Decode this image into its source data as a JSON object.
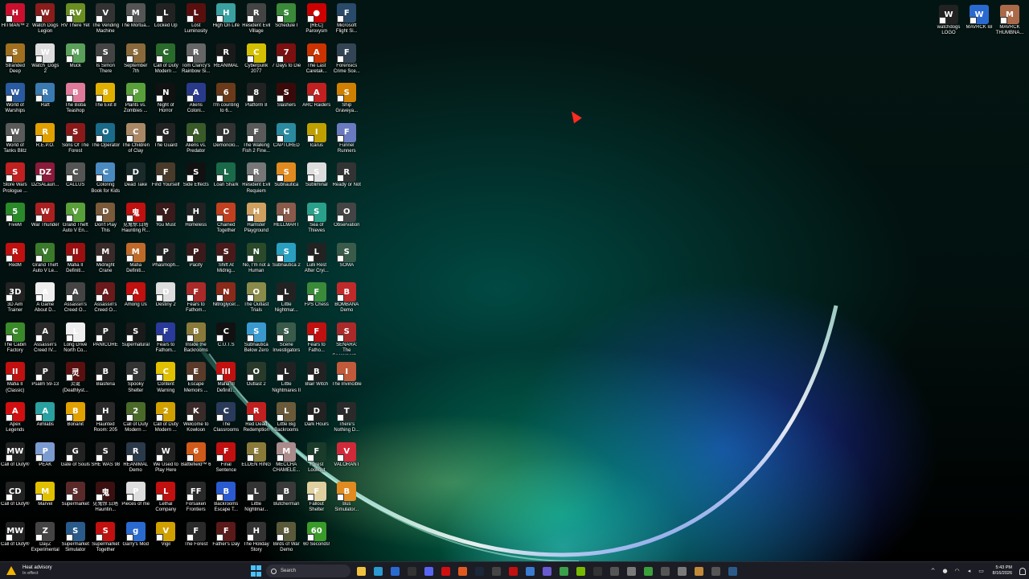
{
  "desktop": {
    "icons": [
      {
        "label": "HITMAN™ 2",
        "glyph": "H",
        "color": "#c8102e"
      },
      {
        "label": "Watch Dogs Legion",
        "glyph": "W",
        "color": "#8a1c1c"
      },
      {
        "label": "RV There Yet",
        "glyph": "RV",
        "color": "#6b8e23"
      },
      {
        "label": "The Vending Machine",
        "glyph": "V",
        "color": "#333333"
      },
      {
        "label": "The Mortua...",
        "glyph": "M",
        "color": "#555555"
      },
      {
        "label": "Locked Up",
        "glyph": "L",
        "color": "#222222"
      },
      {
        "label": "Lost Luminosity",
        "glyph": "L",
        "color": "#5a0f0f"
      },
      {
        "label": "High On Life",
        "glyph": "H",
        "color": "#3aa0a0"
      },
      {
        "label": "Resident Evil Village",
        "glyph": "R",
        "color": "#444444"
      },
      {
        "label": "Schedule I",
        "glyph": "S",
        "color": "#3a8a3a"
      },
      {
        "label": "[REC] Paroxysm",
        "glyph": "●",
        "color": "#cc0000"
      },
      {
        "label": "Microsoft Flight Si...",
        "glyph": "F",
        "color": "#2a4a6a"
      },
      {
        "label": "Stranded Deep",
        "glyph": "S",
        "color": "#a07020"
      },
      {
        "label": "Watch_Dogs 2",
        "glyph": "W",
        "color": "#dddddd"
      },
      {
        "label": "Muck",
        "glyph": "M",
        "color": "#5aa05a"
      },
      {
        "label": "Is Simon There",
        "glyph": "S",
        "color": "#444444"
      },
      {
        "label": "September 7th",
        "glyph": "S",
        "color": "#8a6a3a"
      },
      {
        "label": "Call of Duty Modern ...",
        "glyph": "C",
        "color": "#2a6a2a"
      },
      {
        "label": "Tom Clancy's Rainbow Si...",
        "glyph": "R",
        "color": "#666666"
      },
      {
        "label": "REANIMAL",
        "glyph": "R",
        "color": "#1a1a1a"
      },
      {
        "label": "Cyberpunk 2077",
        "glyph": "C",
        "color": "#d4c000"
      },
      {
        "label": "7 Days to Die",
        "glyph": "7",
        "color": "#7a1010"
      },
      {
        "label": "The Last Caretak...",
        "glyph": "A",
        "color": "#cc3300"
      },
      {
        "label": "Forensics Crime Sce...",
        "glyph": "F",
        "color": "#334455"
      },
      {
        "label": "World of Warships",
        "glyph": "W",
        "color": "#2a5aa0"
      },
      {
        "label": "Raft",
        "glyph": "R",
        "color": "#3a7ab0"
      },
      {
        "label": "The Boba Teashop",
        "glyph": "B",
        "color": "#e07a9a"
      },
      {
        "label": "The Exit 8",
        "glyph": "8",
        "color": "#e0b000"
      },
      {
        "label": "Plants vs. Zombies ...",
        "glyph": "P",
        "color": "#5aa03a"
      },
      {
        "label": "Night of Horror",
        "glyph": "N",
        "color": "#111111"
      },
      {
        "label": "Aliens Coloni...",
        "glyph": "A",
        "color": "#2a3a8a"
      },
      {
        "label": "I'm counting to 6...",
        "glyph": "6",
        "color": "#6a3a1a"
      },
      {
        "label": "Platform 8",
        "glyph": "8",
        "color": "#222222"
      },
      {
        "label": "Slashers",
        "glyph": "S",
        "color": "#3a0a0a"
      },
      {
        "label": "ARC Raiders",
        "glyph": "A",
        "color": "#c02020"
      },
      {
        "label": "Ship Graveya...",
        "glyph": "S",
        "color": "#d08000"
      },
      {
        "label": "World of Tanks Blitz",
        "glyph": "W",
        "color": "#5a5a5a"
      },
      {
        "label": "R.E.P.O.",
        "glyph": "R",
        "color": "#e0a000"
      },
      {
        "label": "Sons Of The Forest",
        "glyph": "S",
        "color": "#8a1a1a"
      },
      {
        "label": "The Operator",
        "glyph": "O",
        "color": "#1a6a8a"
      },
      {
        "label": "The Children of Clay",
        "glyph": "C",
        "color": "#aa8866"
      },
      {
        "label": "The Guard",
        "glyph": "G",
        "color": "#222222"
      },
      {
        "label": "Aliens vs. Predator",
        "glyph": "A",
        "color": "#3a5a2a"
      },
      {
        "label": "Demonolo...",
        "glyph": "D",
        "color": "#333333"
      },
      {
        "label": "The Walking Fish 2 Fine...",
        "glyph": "F",
        "color": "#5a5a5a"
      },
      {
        "label": "CAPTURED",
        "glyph": "C",
        "color": "#2a8aa0"
      },
      {
        "label": "Icarus",
        "glyph": "I",
        "color": "#c0a000"
      },
      {
        "label": "Funnel Runners",
        "glyph": "F",
        "color": "#6a7ac0"
      },
      {
        "label": "Store Wars Prologue ...",
        "glyph": "S",
        "color": "#c02020"
      },
      {
        "label": "DZSALaun...",
        "glyph": "DZ",
        "color": "#8a1a3a"
      },
      {
        "label": "CALLUS",
        "glyph": "C",
        "color": "#555555"
      },
      {
        "label": "Coloring Book for Kids",
        "glyph": "C",
        "color": "#4a8ac0"
      },
      {
        "label": "Dead Take",
        "glyph": "D",
        "color": "#1a2a2a"
      },
      {
        "label": "Find Yourself",
        "glyph": "F",
        "color": "#4a3a2a"
      },
      {
        "label": "Side Effects",
        "glyph": "S",
        "color": "#111111"
      },
      {
        "label": "Loan Shark",
        "glyph": "L",
        "color": "#1a6a4a"
      },
      {
        "label": "Resident Evil Requiem",
        "glyph": "R",
        "color": "#777777"
      },
      {
        "label": "Subnautica",
        "glyph": "S",
        "color": "#e08a20"
      },
      {
        "label": "Subliminal",
        "glyph": "S",
        "color": "#dddddd"
      },
      {
        "label": "Ready or Not",
        "glyph": "R",
        "color": "#333333"
      },
      {
        "label": "FiveM",
        "glyph": "5",
        "color": "#2a8a2a"
      },
      {
        "label": "War Thunder",
        "glyph": "W",
        "color": "#aa2020"
      },
      {
        "label": "Grand Theft Auto V En...",
        "glyph": "V",
        "color": "#5aa03a"
      },
      {
        "label": "Don't Play This",
        "glyph": "D",
        "color": "#7a5a3a"
      },
      {
        "label": "见鬼惊:白塔 Haunting R...",
        "glyph": "鬼",
        "color": "#c01010"
      },
      {
        "label": "You Must",
        "glyph": "Y",
        "color": "#3a1a1a"
      },
      {
        "label": "Homeless",
        "glyph": "H",
        "color": "#222222"
      },
      {
        "label": "Chained Together",
        "glyph": "C",
        "color": "#c04020"
      },
      {
        "label": "Hamster Playground",
        "glyph": "H",
        "color": "#d0a060"
      },
      {
        "label": "HELLMART",
        "glyph": "H",
        "color": "#8a5a4a"
      },
      {
        "label": "Sea of Thieves",
        "glyph": "S",
        "color": "#2aa08a"
      },
      {
        "label": "Observation",
        "glyph": "O",
        "color": "#444444"
      },
      {
        "label": "RedM",
        "glyph": "R",
        "color": "#c01010"
      },
      {
        "label": "Grand Theft Auto V Le...",
        "glyph": "V",
        "color": "#3a7a2a"
      },
      {
        "label": "Mafia II Definiti...",
        "glyph": "II",
        "color": "#9a1010"
      },
      {
        "label": "Midnight Crane",
        "glyph": "M",
        "color": "#3a2a2a"
      },
      {
        "label": "Mafia Definiti...",
        "glyph": "M",
        "color": "#c06a2a"
      },
      {
        "label": "Phasmoph...",
        "glyph": "P",
        "color": "#222222"
      },
      {
        "label": "Pacify",
        "glyph": "P",
        "color": "#3a1a1a"
      },
      {
        "label": "Shift At Midnig...",
        "glyph": "S",
        "color": "#4a1a1a"
      },
      {
        "label": "No, I'm not a Human",
        "glyph": "N",
        "color": "#2a4a2a"
      },
      {
        "label": "Subnautica 2",
        "glyph": "S",
        "color": "#2aa0c0"
      },
      {
        "label": "Lulli Rest After Cryi...",
        "glyph": "L",
        "color": "#222222"
      },
      {
        "label": "SOMA",
        "glyph": "S",
        "color": "#3a5a4a"
      },
      {
        "label": "3D Aim Trainer",
        "glyph": "3D",
        "color": "#222222"
      },
      {
        "label": "A Game About D...",
        "glyph": "A",
        "color": "#eeeeee"
      },
      {
        "label": "Assassin's Creed O...",
        "glyph": "A",
        "color": "#444444"
      },
      {
        "label": "Assassin's Creed O...",
        "glyph": "A",
        "color": "#6a1a1a"
      },
      {
        "label": "Among Us",
        "glyph": "A",
        "color": "#c01010"
      },
      {
        "label": "Destiny 2",
        "glyph": "D",
        "color": "#dddddd"
      },
      {
        "label": "Fears to Fathom...",
        "glyph": "F",
        "color": "#aa2a2a"
      },
      {
        "label": "Nitroglycer...",
        "glyph": "N",
        "color": "#8a2a1a"
      },
      {
        "label": "The Outlast Trials",
        "glyph": "O",
        "color": "#8a8a4a"
      },
      {
        "label": "Little Nightmar...",
        "glyph": "L",
        "color": "#222222"
      },
      {
        "label": "FPS Chess",
        "glyph": "F",
        "color": "#3a8a3a"
      },
      {
        "label": "BOMBANA Demo",
        "glyph": "B",
        "color": "#c02a2a"
      },
      {
        "label": "The Cabin Factory",
        "glyph": "C",
        "color": "#3a8a2a"
      },
      {
        "label": "Assassin's Creed IV...",
        "glyph": "A",
        "color": "#2a2a2a"
      },
      {
        "label": "Long Drive North Co...",
        "glyph": "L",
        "color": "#eeeeee"
      },
      {
        "label": "PANICORE",
        "glyph": "P",
        "color": "#222222"
      },
      {
        "label": "Supernatural",
        "glyph": "S",
        "color": "#1a1a1a"
      },
      {
        "label": "Fears to Fathom...",
        "glyph": "F",
        "color": "#2a3a9a"
      },
      {
        "label": "Inside the Backrooms",
        "glyph": "B",
        "color": "#8a7a3a"
      },
      {
        "label": "C.U.T.S",
        "glyph": "C",
        "color": "#111111"
      },
      {
        "label": "Subnautica Below Zero",
        "glyph": "S",
        "color": "#3a9ad0"
      },
      {
        "label": "Scene Investigators",
        "glyph": "S",
        "color": "#3a5a4a"
      },
      {
        "label": "Fears to Fatho...",
        "glyph": "F",
        "color": "#c01010"
      },
      {
        "label": "SENARA: The Sacrament ...",
        "glyph": "S",
        "color": "#aa2a2a"
      },
      {
        "label": "Mafia II (Classic)",
        "glyph": "II",
        "color": "#c01010"
      },
      {
        "label": "Psalm 59-13",
        "glyph": "P",
        "color": "#222222"
      },
      {
        "label": "灵诞 (Deathlyst...",
        "glyph": "灵",
        "color": "#5a1010"
      },
      {
        "label": "Blasferia",
        "glyph": "B",
        "color": "#222222"
      },
      {
        "label": "Spooky Shelter",
        "glyph": "S",
        "color": "#333333"
      },
      {
        "label": "Content Warning",
        "glyph": "C",
        "color": "#e0c000"
      },
      {
        "label": "Escape Memoirs ...",
        "glyph": "E",
        "color": "#5a3a2a"
      },
      {
        "label": "Mafia III Definiti...",
        "glyph": "III",
        "color": "#c01010"
      },
      {
        "label": "Outlast 2",
        "glyph": "O",
        "color": "#2a3a2a"
      },
      {
        "label": "Little Nightmares II",
        "glyph": "L",
        "color": "#222222"
      },
      {
        "label": "Blair Witch",
        "glyph": "B",
        "color": "#222222"
      },
      {
        "label": "The Invincible",
        "glyph": "I",
        "color": "#c05a3a"
      },
      {
        "label": "Apex Legends",
        "glyph": "A",
        "color": "#d01010"
      },
      {
        "label": "Aimlabs",
        "glyph": "A",
        "color": "#2aa0a0"
      },
      {
        "label": "Bonanit",
        "glyph": "B",
        "color": "#e0a000"
      },
      {
        "label": "Haunted Room: 205",
        "glyph": "H",
        "color": "#2a2a2a"
      },
      {
        "label": "Call of Duty Modern ...",
        "glyph": "2",
        "color": "#4a6a2a"
      },
      {
        "label": "Call of Duty Modern ...",
        "glyph": "2",
        "color": "#d0a000"
      },
      {
        "label": "Welcome to Kowloon",
        "glyph": "K",
        "color": "#3a2a2a"
      },
      {
        "label": "The Classrooms",
        "glyph": "C",
        "color": "#2a3a5a"
      },
      {
        "label": "Red Dead Redemption",
        "glyph": "R",
        "color": "#c02020"
      },
      {
        "label": "Little Big Backrooms",
        "glyph": "L",
        "color": "#6a5a3a"
      },
      {
        "label": "Dark Hours",
        "glyph": "D",
        "color": "#222222"
      },
      {
        "label": "There's Nothing D...",
        "glyph": "T",
        "color": "#2a2a2a"
      },
      {
        "label": "Call of Duty®",
        "glyph": "MW",
        "color": "#222222"
      },
      {
        "label": "PEAK",
        "glyph": "P",
        "color": "#7a9ad0"
      },
      {
        "label": "Gate of Souls",
        "glyph": "G",
        "color": "#222222"
      },
      {
        "label": "SHE WAS 98",
        "glyph": "S",
        "color": "#222222"
      },
      {
        "label": "REANIMAL Demo",
        "glyph": "R",
        "color": "#2a3a4a"
      },
      {
        "label": "We Used to Play Here",
        "glyph": "W",
        "color": "#222222"
      },
      {
        "label": "Battlefield™ 6",
        "glyph": "6",
        "color": "#d05a1a"
      },
      {
        "label": "Final Sentence",
        "glyph": "F",
        "color": "#c01010"
      },
      {
        "label": "ELDEN RING",
        "glyph": "E",
        "color": "#8a7a3a"
      },
      {
        "label": "MECCHA CHAMELE...",
        "glyph": "M",
        "color": "#aa8a8a"
      },
      {
        "label": "Forest Lookout",
        "glyph": "F",
        "color": "#1a3a2a"
      },
      {
        "label": "VALORANT",
        "glyph": "V",
        "color": "#d02a3a"
      },
      {
        "label": "Call of Duty®",
        "glyph": "CD",
        "color": "#222222"
      },
      {
        "label": "Marvel",
        "glyph": "M",
        "color": "#e0c000"
      },
      {
        "label": "Supermarket",
        "glyph": "S",
        "color": "#5a2a2a"
      },
      {
        "label": "见鬼惊:白塔 Hauntin...",
        "glyph": "鬼",
        "color": "#3a1010"
      },
      {
        "label": "Pieces of me",
        "glyph": "P",
        "color": "#dddddd"
      },
      {
        "label": "Lethal Company",
        "glyph": "L",
        "color": "#c01010"
      },
      {
        "label": "Forsaken Frontiers",
        "glyph": "FF",
        "color": "#2a2a2a"
      },
      {
        "label": "Backrooms Escape T...",
        "glyph": "B",
        "color": "#2a5ad0"
      },
      {
        "label": "Little Nightmar...",
        "glyph": "L",
        "color": "#333333"
      },
      {
        "label": "Butcherman",
        "glyph": "B",
        "color": "#3a3a3a"
      },
      {
        "label": "Fallout Shelter",
        "glyph": "F",
        "color": "#e0d0a0"
      },
      {
        "label": "Bus Simulator...",
        "glyph": "B",
        "color": "#e08a20"
      },
      {
        "label": "Call of Duty®",
        "glyph": "MW",
        "color": "#222222"
      },
      {
        "label": "DayZ Experimental",
        "glyph": "Z",
        "color": "#444444"
      },
      {
        "label": "Supermarket Simulator",
        "glyph": "S",
        "color": "#2a5a8a"
      },
      {
        "label": "Supermarket Together",
        "glyph": "S",
        "color": "#c01010"
      },
      {
        "label": "Garry's Mod",
        "glyph": "g",
        "color": "#2a6ad0"
      },
      {
        "label": "Vigil",
        "glyph": "V",
        "color": "#d0a000"
      },
      {
        "label": "The Forest",
        "glyph": "F",
        "color": "#2a2a2a"
      },
      {
        "label": "Father's Day",
        "glyph": "F",
        "color": "#5a1a1a"
      },
      {
        "label": "The Holiday Story",
        "glyph": "H",
        "color": "#333333"
      },
      {
        "label": "Birds of War Demo",
        "glyph": "B",
        "color": "#5a5a3a"
      },
      {
        "label": "60 Seconds!",
        "glyph": "60",
        "color": "#3a9a2a"
      }
    ],
    "right_icons": [
      {
        "label": "watchdogs LOGO",
        "glyph": "W",
        "color": "#222222"
      },
      {
        "label": "MAVRCK lol",
        "glyph": "W",
        "color": "#2a6ad0"
      },
      {
        "label": "MAVRCK THUMBNA...",
        "glyph": "M",
        "color": "#aa6a4a"
      }
    ]
  },
  "taskbar": {
    "weather_title": "Heat advisory",
    "weather_sub": "In effect",
    "search_placeholder": "Search",
    "time": "5:43 PM",
    "date": "8/16/2026",
    "apps": [
      {
        "name": "file-explorer",
        "color": "#f0c040"
      },
      {
        "name": "edge",
        "color": "#2a9ad0"
      },
      {
        "name": "calendar",
        "color": "#2a6ad0"
      },
      {
        "name": "terminal",
        "color": "#333333"
      },
      {
        "name": "discord",
        "color": "#5865f2"
      },
      {
        "name": "opera",
        "color": "#d01010"
      },
      {
        "name": "brave",
        "color": "#e05a20"
      },
      {
        "name": "steam",
        "color": "#1b2838"
      },
      {
        "name": "app-9",
        "color": "#444444"
      },
      {
        "name": "app-10",
        "color": "#c01010"
      },
      {
        "name": "app-11",
        "color": "#3a7ad0"
      },
      {
        "name": "app-12",
        "color": "#6a5ad0"
      },
      {
        "name": "chrome",
        "color": "#3aa04a"
      },
      {
        "name": "nvidia",
        "color": "#76b900"
      },
      {
        "name": "obs",
        "color": "#333333"
      },
      {
        "name": "app-16",
        "color": "#555555"
      },
      {
        "name": "app-17",
        "color": "#7a7a7a"
      },
      {
        "name": "xbox",
        "color": "#3aa03a"
      },
      {
        "name": "app-19",
        "color": "#555555"
      },
      {
        "name": "app-20",
        "color": "#7a7a7a"
      },
      {
        "name": "app-21",
        "color": "#c08a3a"
      },
      {
        "name": "app-22",
        "color": "#555555"
      },
      {
        "name": "steam-2",
        "color": "#2a5a8a"
      }
    ]
  },
  "colors": {
    "taskbar_bg": "#1c1c24",
    "start_accent": "#4cc2ff",
    "cursor": "#ff2a20"
  }
}
